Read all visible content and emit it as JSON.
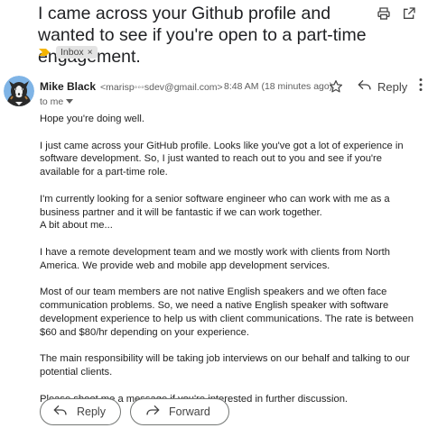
{
  "email": {
    "subject": "I came across your Github profile and wanted to see if you're open to a part-time engagement.",
    "label": "Inbox",
    "sender_name": "Mike Black",
    "sender_email": "<marisp◦◦◦sdev@gmail.com>",
    "time": "8:48 AM (18 minutes ago)",
    "reply_label": "Reply",
    "to_me": "to me",
    "body": [
      "Hope you're doing well.",
      "I just came across your GitHub profile. Looks like you've got a lot of experience in software development. So, I just wanted to reach out to you and see if you're available for a part-time role.",
      "I'm currently looking for a senior software engineer who can work with me as a business partner and it will be fantastic if we can work together.",
      "A bit about me...",
      "I have a remote development team and we mostly work with clients from North America. We provide web and mobile app development services.",
      "Most of our team members are not native English speakers and we often face communication problems. So, we need a native English speaker with software development experience to help us with client communications. The rate is between $60 and $80/hr depending on your experience.",
      "The main responsibility will be taking job interviews on our behalf and talking to our potential clients.",
      "Please shoot me a message if you're interested in further discussion."
    ]
  },
  "actions": {
    "reply": "Reply",
    "forward": "Forward"
  },
  "icons": {
    "print": "printer-icon",
    "open_new_window": "open-in-new-icon",
    "importance": "importance-marker-icon",
    "star": "star-icon",
    "reply": "reply-arrow-icon",
    "more": "more-vert-icon",
    "to_me_dropdown": "chevron-down-icon",
    "forward": "forward-arrow-icon"
  },
  "colors": {
    "importance": "#f4b400",
    "chip_bg": "#e3e3e3",
    "text": "#202124",
    "secondary": "#5e5e5e"
  }
}
